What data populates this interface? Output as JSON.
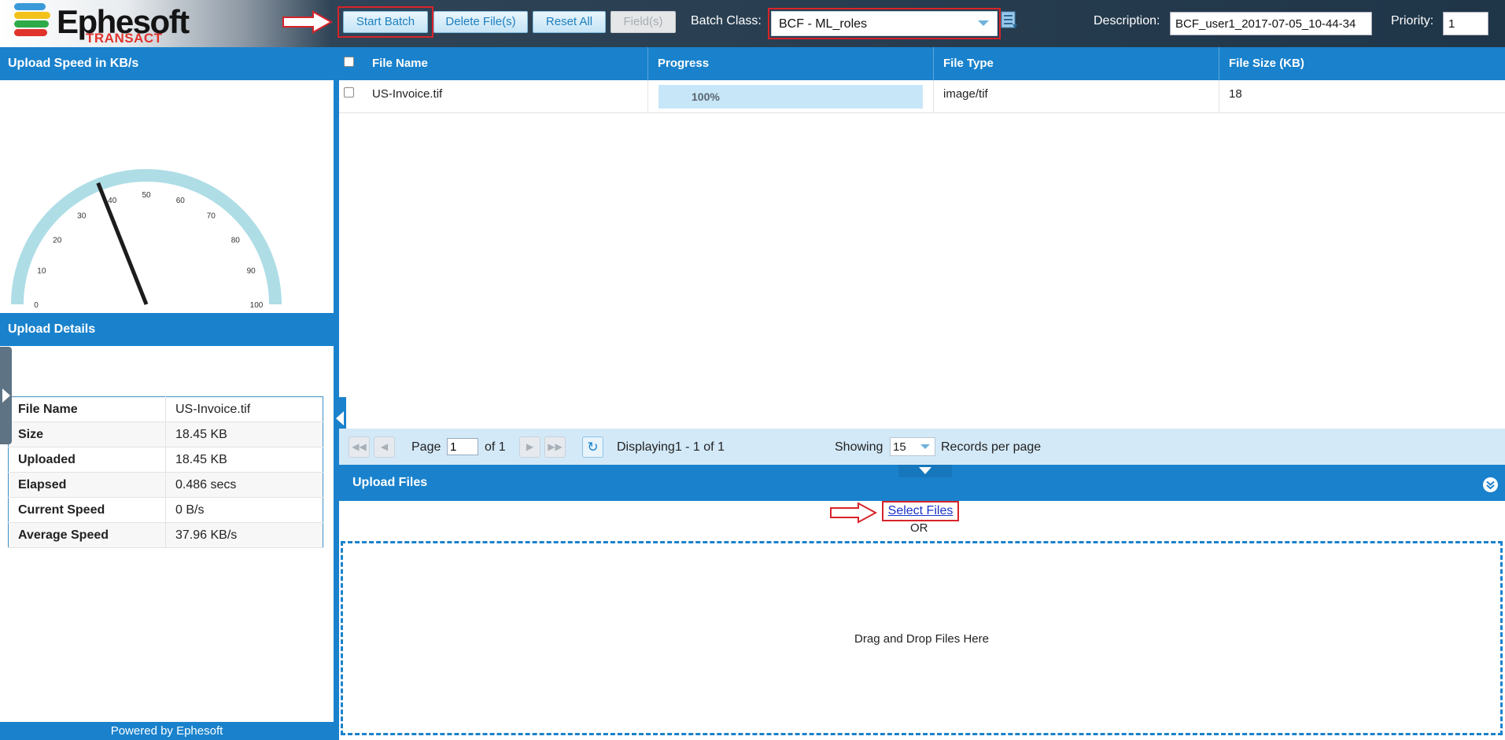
{
  "header": {
    "logo_name": "Ephesoft",
    "logo_sub": "TRANSACT",
    "buttons": {
      "start_batch": "Start Batch",
      "delete_files": "Delete File(s)",
      "reset_all": "Reset All",
      "fields": "Field(s)"
    },
    "batch_class_label": "Batch Class:",
    "batch_class_value": "BCF - ML_roles",
    "description_label": "Description:",
    "description_value": "BCF_user1_2017-07-05_10-44-34",
    "priority_label": "Priority:",
    "priority_value": "1"
  },
  "colors": {
    "accent": "#1a82cc",
    "highlight": "#d8232a",
    "header_dark": "#1f3548"
  },
  "upload_speed": {
    "title": "Upload Speed in KB/s",
    "gauge": {
      "min": 0,
      "max": 100,
      "ticks": [
        "0",
        "10",
        "20",
        "30",
        "40",
        "50",
        "60",
        "70",
        "80",
        "90",
        "100"
      ],
      "value": 37.96
    }
  },
  "upload_details": {
    "title": "Upload Details",
    "rows": [
      {
        "label": "File Name",
        "value": "US-Invoice.tif"
      },
      {
        "label": "Size",
        "value": "18.45 KB"
      },
      {
        "label": "Uploaded",
        "value": "18.45 KB"
      },
      {
        "label": "Elapsed",
        "value": "0.486 secs"
      },
      {
        "label": "Current Speed",
        "value": "0 B/s"
      },
      {
        "label": "Average Speed",
        "value": "37.96 KB/s"
      }
    ]
  },
  "footer": {
    "powered_by": "Powered by Ephesoft"
  },
  "grid": {
    "columns": [
      "File Name",
      "Progress",
      "File Type",
      "File Size (KB)"
    ],
    "rows": [
      {
        "file_name": "US-Invoice.tif",
        "progress_text": "100%",
        "progress": 1.0,
        "file_type": "image/tif",
        "file_size": "18"
      }
    ]
  },
  "pager": {
    "page_label": "Page",
    "page_value": "1",
    "of_label": "of 1",
    "displaying": "Displaying1 - 1 of 1",
    "showing_label": "Showing",
    "records_value": "15",
    "records_label": "Records per page"
  },
  "upload_files": {
    "title": "Upload Files",
    "select_files": "Select Files",
    "or_text": "OR",
    "drop_text": "Drag and Drop Files Here"
  },
  "icons": [
    "arrow-right-icon",
    "batch-class-list-icon",
    "first-page-icon",
    "prev-page-icon",
    "next-page-icon",
    "last-page-icon",
    "refresh-icon",
    "collapse-chevron-icon"
  ]
}
